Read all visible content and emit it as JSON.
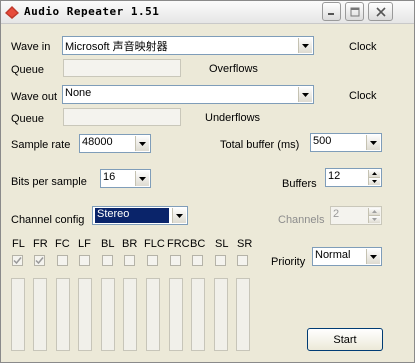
{
  "window": {
    "title": "Audio Repeater 1.51"
  },
  "wave_in": {
    "label": "Wave in",
    "value": "Microsoft 声音映射器",
    "clock_label": "Clock",
    "queue_label": "Queue",
    "overflows_label": "Overflows"
  },
  "wave_out": {
    "label": "Wave out",
    "value": "None",
    "clock_label": "Clock",
    "queue_label": "Queue",
    "underflows_label": "Underflows"
  },
  "sample_rate": {
    "label": "Sample rate",
    "value": "48000"
  },
  "total_buffer": {
    "label": "Total buffer (ms)",
    "value": "500"
  },
  "bits_per_sample": {
    "label": "Bits per sample",
    "value": "16"
  },
  "buffers": {
    "label": "Buffers",
    "value": "12"
  },
  "channel_config": {
    "label": "Channel config",
    "value": "Stereo"
  },
  "channels": {
    "label": "Channels",
    "value": "2"
  },
  "priority": {
    "label": "Priority",
    "value": "Normal"
  },
  "channel_labels": [
    "FL",
    "FR",
    "FC",
    "LF",
    "BL",
    "BR",
    "FLC",
    "FRC",
    "BC",
    "SL",
    "SR"
  ],
  "channel_checked": [
    true,
    true,
    false,
    false,
    false,
    false,
    false,
    false,
    false,
    false,
    false
  ],
  "start_button": "Start",
  "colors": {
    "window_bg": "#ece9d8",
    "field_border": "#7f9db9",
    "selection": "#0a246a"
  }
}
